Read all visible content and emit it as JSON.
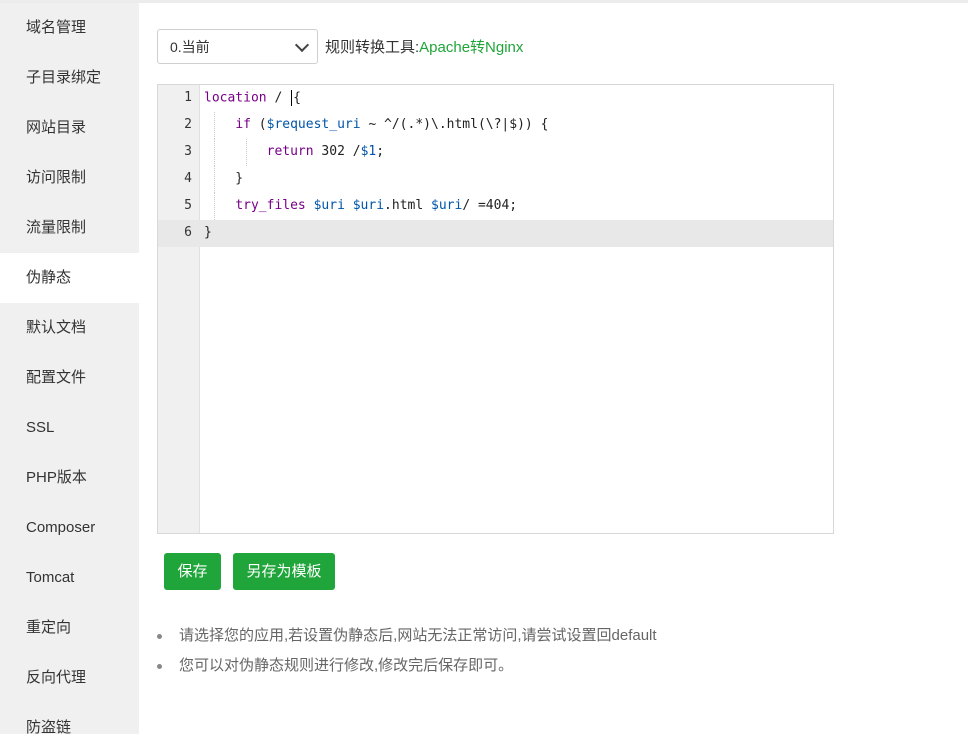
{
  "sidebar": {
    "items": [
      "域名管理",
      "子目录绑定",
      "网站目录",
      "访问限制",
      "流量限制",
      "伪静态",
      "默认文档",
      "配置文件",
      "SSL",
      "PHP版本",
      "Composer",
      "Tomcat",
      "重定向",
      "反向代理",
      "防盗链"
    ],
    "active_index": 5
  },
  "toolbar": {
    "select_value": "0.当前",
    "tool_label": "规则转换工具:",
    "tool_link": "Apache转Nginx"
  },
  "editor": {
    "line_numbers": [
      "1",
      "2",
      "3",
      "4",
      "5",
      "6"
    ],
    "lines": [
      "location / {",
      "    if ($request_uri ~ ^/(.*)\\.html(\\?|$)) {",
      "        return 302 /$1;",
      "    }",
      "    try_files $uri $uri.html $uri/ =404;",
      "}"
    ],
    "active_line": 6
  },
  "buttons": {
    "save": "保存",
    "save_as_template": "另存为模板"
  },
  "notes": [
    "请选择您的应用,若设置伪静态后,网站无法正常访问,请尝试设置回default",
    "您可以对伪静态规则进行修改,修改完后保存即可。"
  ],
  "colors": {
    "accent": "#20a53a"
  }
}
